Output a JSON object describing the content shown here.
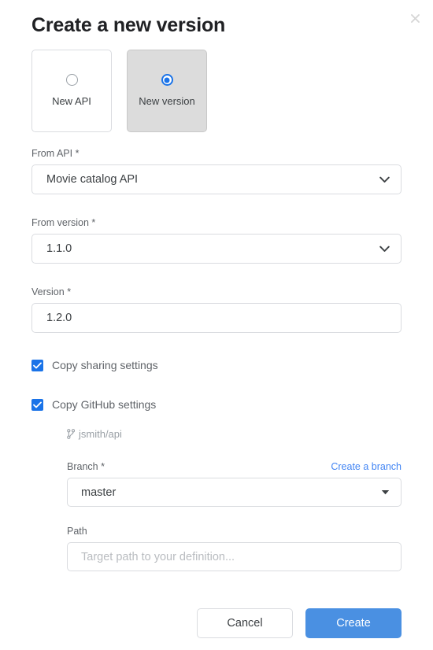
{
  "dialog": {
    "title": "Create a new version",
    "close_icon": "close-icon"
  },
  "mode_tiles": [
    {
      "label": "New API",
      "selected": false
    },
    {
      "label": "New version",
      "selected": true
    }
  ],
  "fields": {
    "from_api": {
      "label": "From API",
      "required_mark": "*",
      "value": "Movie catalog API",
      "icon": "chevron-down-icon"
    },
    "from_version": {
      "label": "From version",
      "required_mark": "*",
      "value": "1.1.0",
      "icon": "chevron-down-icon"
    },
    "version": {
      "label": "Version",
      "required_mark": "*",
      "value": "1.2.0"
    }
  },
  "checkboxes": {
    "copy_sharing": {
      "label": "Copy sharing settings",
      "checked": true
    },
    "copy_github": {
      "label": "Copy GitHub settings",
      "checked": true
    }
  },
  "github": {
    "repo": "jsmith/api",
    "repo_icon": "git-branch-icon",
    "branch": {
      "label": "Branch",
      "required_mark": "*",
      "value": "master",
      "link_label": "Create a branch",
      "icon": "triangle-down-icon"
    },
    "path": {
      "label": "Path",
      "value": "",
      "placeholder": "Target path to your definition..."
    }
  },
  "footer": {
    "cancel_label": "Cancel",
    "create_label": "Create"
  },
  "colors": {
    "accent_blue": "#1a73e8",
    "button_blue": "#4a90e2",
    "link_blue": "#4285f4",
    "selected_tile_bg": "#dcdcdc",
    "border": "#dadce0",
    "label_gray": "#5f6368",
    "placeholder_gray": "#b9bcc0"
  }
}
